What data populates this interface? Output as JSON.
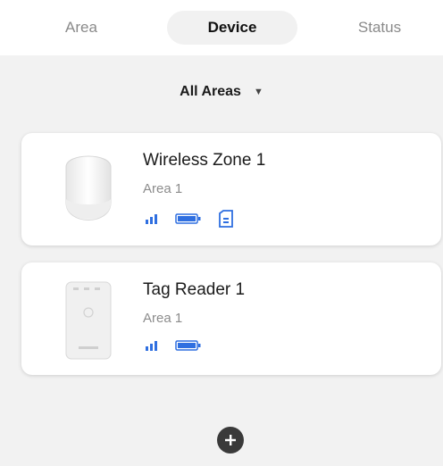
{
  "tabs": [
    {
      "label": "Area",
      "active": false
    },
    {
      "label": "Device",
      "active": true
    },
    {
      "label": "Status",
      "active": false
    }
  ],
  "filter": {
    "label": "All Areas",
    "icon": "caret-down-icon"
  },
  "devices": [
    {
      "name": "Wireless Zone 1",
      "area": "Area 1",
      "icons": [
        "signal-icon",
        "battery-icon",
        "tamper-status-icon"
      ]
    },
    {
      "name": "Tag Reader 1",
      "area": "Area 1",
      "icons": [
        "signal-icon",
        "battery-icon"
      ]
    }
  ],
  "add_button": {
    "icon": "plus-icon"
  },
  "colors": {
    "accent": "#2f6fe0",
    "background": "#f2f2f2",
    "card": "#ffffff",
    "inactive_tab": "#8a8a8a",
    "add_button": "#3a3a3a"
  }
}
